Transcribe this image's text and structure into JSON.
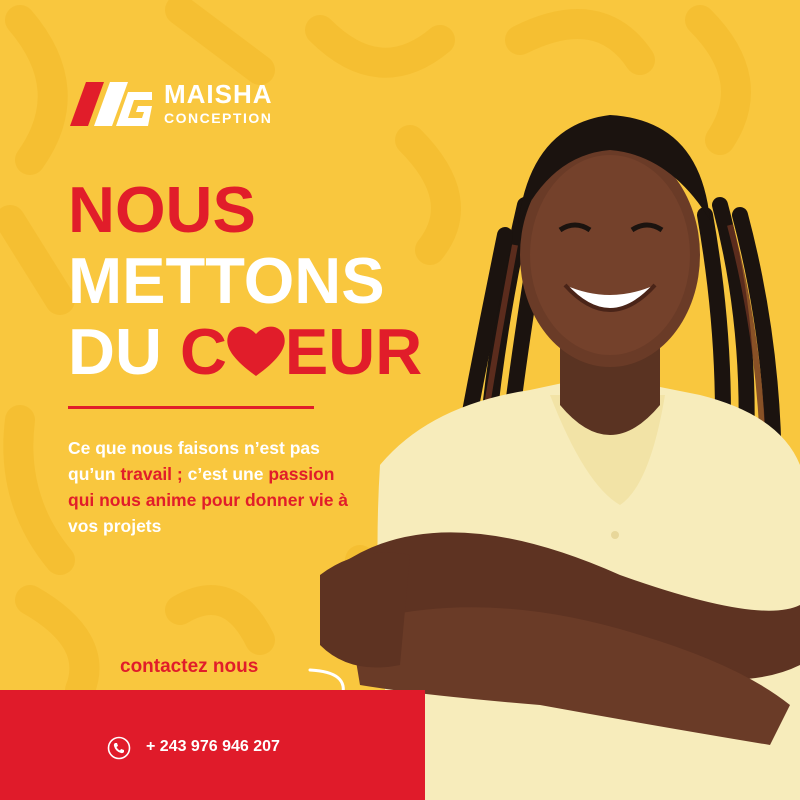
{
  "brand": {
    "name": "MAISHA",
    "subtitle": "CONCEPTION"
  },
  "headline": {
    "line1": "NOUS",
    "line2": "METTONS",
    "line3_prefix": "DU ",
    "line3_c": "C",
    "line3_suffix": "EUR"
  },
  "body_text": {
    "part1": "Ce que nous faisons n’est pas qu’un ",
    "highlight1": "travail ;",
    "part2": " c’est une ",
    "highlight2": "passion qui nous anime pour donner vie à",
    "part3": " vos projets"
  },
  "cta": {
    "label": "contactez nous"
  },
  "contact": {
    "phone": "+ 243 976 946 207"
  },
  "colors": {
    "background": "#f9c73e",
    "accent_red": "#e11d2a",
    "text_white": "#ffffff"
  },
  "icons": [
    "brand-logo-icon",
    "heart-icon",
    "curved-arrow-icon",
    "phone-icon"
  ]
}
